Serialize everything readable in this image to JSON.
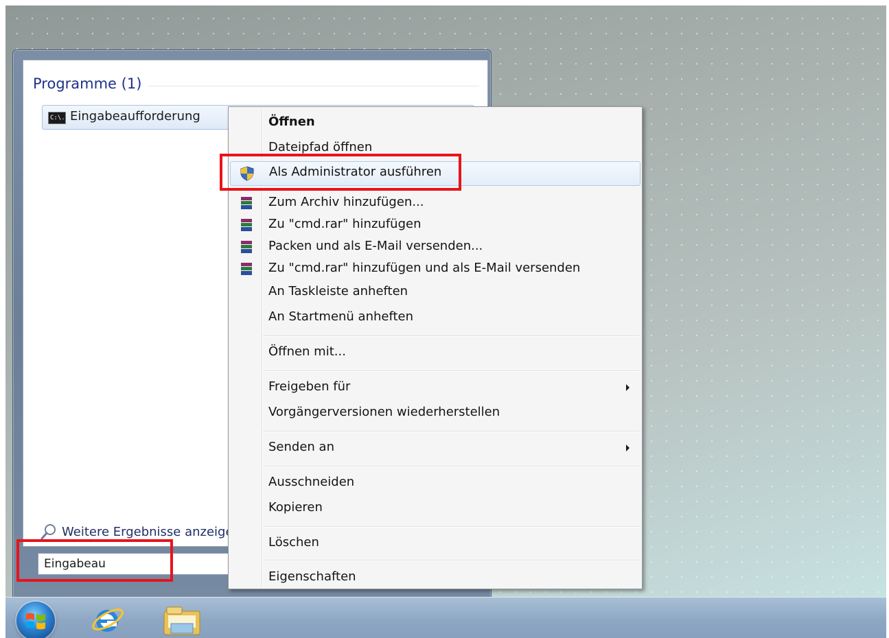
{
  "start_menu": {
    "programs_header": "Programme (1)",
    "program_item": {
      "label": "Eingabeaufforderung",
      "icon_text": "C:\\."
    },
    "more_results": "Weitere Ergebnisse anzeigen",
    "search_value": "Eingabeau"
  },
  "context_menu": {
    "items": [
      {
        "label": "Öffnen",
        "bold": true
      },
      {
        "label": "Dateipfad öffnen"
      },
      {
        "label": "Als Administrator ausführen",
        "icon": "uac-shield-icon",
        "highlighted": true
      },
      {
        "label": "Zum Archiv hinzufügen...",
        "icon": "winrar-icon"
      },
      {
        "label": "Zu \"cmd.rar\" hinzufügen",
        "icon": "winrar-icon"
      },
      {
        "label": "Packen und als E-Mail versenden...",
        "icon": "winrar-icon"
      },
      {
        "label": "Zu \"cmd.rar\" hinzufügen und als E-Mail versenden",
        "icon": "winrar-icon"
      },
      {
        "label": "An Taskleiste anheften"
      },
      {
        "label": "An Startmenü anheften"
      },
      {
        "label": "Öffnen mit..."
      },
      {
        "label": "Freigeben für",
        "submenu": true
      },
      {
        "label": "Vorgängerversionen wiederherstellen"
      },
      {
        "label": "Senden an",
        "submenu": true
      },
      {
        "label": "Ausschneiden"
      },
      {
        "label": "Kopieren"
      },
      {
        "label": "Löschen"
      },
      {
        "label": "Eigenschaften"
      }
    ]
  },
  "taskbar": {
    "items": [
      "start-orb",
      "internet-explorer-icon",
      "windows-explorer-icon"
    ]
  },
  "annotation_color": "#e8141b",
  "accent_color": "#1e3287"
}
